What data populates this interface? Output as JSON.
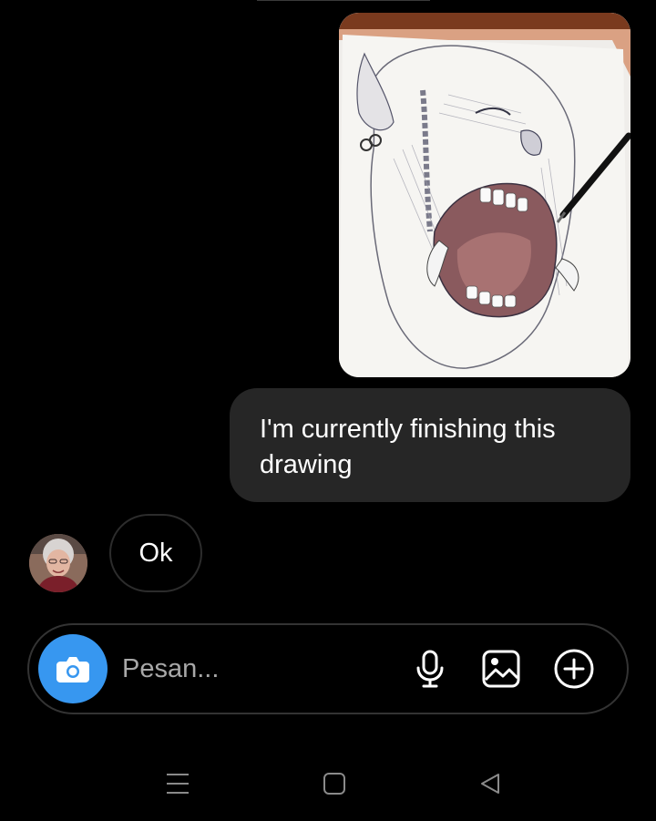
{
  "conversation": {
    "outgoing_text": "I'm currently finishing this drawing",
    "incoming_reply": "Ok"
  },
  "composer": {
    "placeholder": "Pesan..."
  },
  "icons": {
    "camera": "camera-icon",
    "mic": "microphone-icon",
    "gallery": "gallery-icon",
    "plus": "plus-circle-icon",
    "nav_menu": "recent-apps-icon",
    "nav_home": "home-icon",
    "nav_back": "back-icon"
  },
  "colors": {
    "background": "#000000",
    "outgoing_bubble": "#262626",
    "camera_button": "#3797f0",
    "placeholder": "#a8a8a8"
  }
}
